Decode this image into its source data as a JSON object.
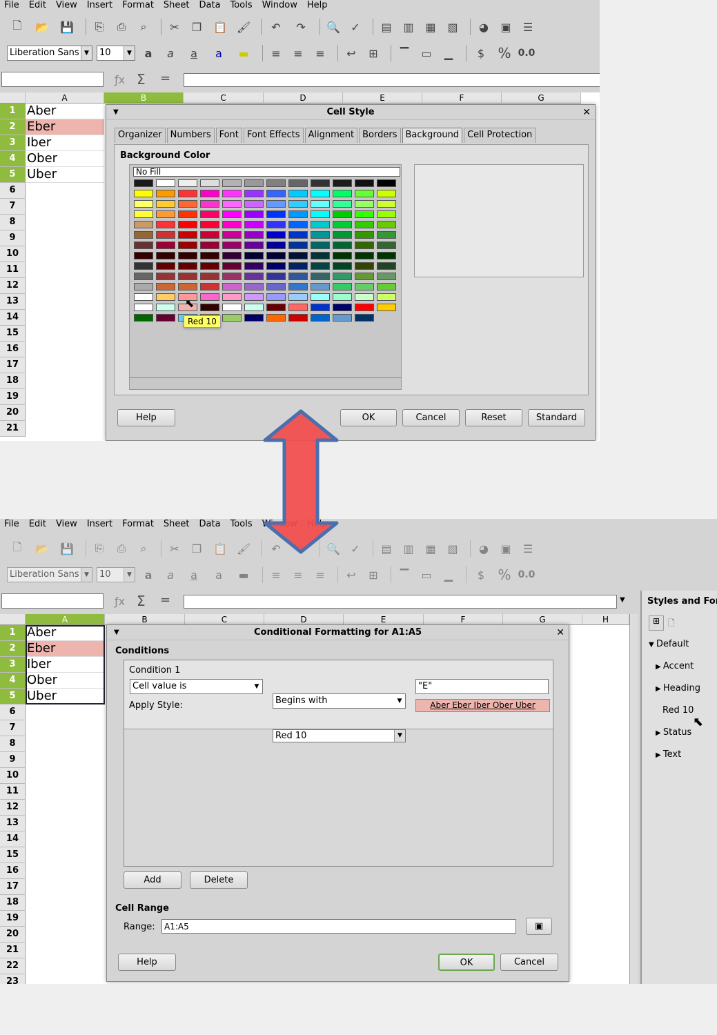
{
  "menu": [
    "File",
    "Edit",
    "View",
    "Insert",
    "Format",
    "Sheet",
    "Data",
    "Tools",
    "Window",
    "Help"
  ],
  "font_name": "Liberation Sans",
  "font_size": "10",
  "toolbar_text": {
    "percent": "%",
    "decimal": "0.0"
  },
  "columns": [
    "A",
    "B",
    "C",
    "D",
    "E",
    "F",
    "G",
    "H"
  ],
  "cells_a": [
    "Aber",
    "Eber",
    "Iber",
    "Ober",
    "Uber"
  ],
  "rows_top": [
    "1",
    "2",
    "3",
    "4",
    "5",
    "6",
    "7",
    "8",
    "9",
    "10",
    "11",
    "12",
    "13",
    "14",
    "15",
    "16",
    "17",
    "18",
    "19",
    "20",
    "21"
  ],
  "rows_bottom": [
    "1",
    "2",
    "3",
    "4",
    "5",
    "6",
    "7",
    "8",
    "9",
    "10",
    "11",
    "12",
    "13",
    "14",
    "15",
    "16",
    "17",
    "18",
    "19",
    "20",
    "21",
    "22",
    "23"
  ],
  "cell_style_dialog": {
    "title": "Cell Style",
    "tabs": [
      "Organizer",
      "Numbers",
      "Font",
      "Font Effects",
      "Alignment",
      "Borders",
      "Background",
      "Cell Protection"
    ],
    "active_tab": "Background",
    "section": "Background Color",
    "no_fill": "No Fill",
    "tooltip": "Red 10",
    "buttons": {
      "help": "Help",
      "ok": "OK",
      "cancel": "Cancel",
      "reset": "Reset",
      "standard": "Standard"
    },
    "palette": [
      [
        "#1a1a1a",
        "#ffffff",
        "#eeeeee",
        "#dddddd",
        "#b2b2b2",
        "#999999",
        "#808080",
        "#666666",
        "#333333",
        "#1c1c1c",
        "#111111",
        "#000000"
      ],
      [
        "#ffff00",
        "#ff9900",
        "#ff3333",
        "#ff00cc",
        "#ff33ff",
        "#9933ff",
        "#3366ff",
        "#00ccff",
        "#00ffff",
        "#00ff66",
        "#66ff33",
        "#ccff00"
      ],
      [
        "#ffff66",
        "#ffcc33",
        "#ff6633",
        "#ff33cc",
        "#ff66ff",
        "#cc66ff",
        "#6699ff",
        "#33ccff",
        "#66ffff",
        "#33ff99",
        "#99ff66",
        "#ccff33"
      ],
      [
        "#ffff33",
        "#ff9933",
        "#ff3300",
        "#ff0066",
        "#ff00ff",
        "#9900ff",
        "#0033ff",
        "#0099ff",
        "#00ffff",
        "#00cc00",
        "#33ff00",
        "#99ff00"
      ],
      [
        "#cc9966",
        "#ff3333",
        "#ff0000",
        "#ff0033",
        "#ff00cc",
        "#cc00ff",
        "#3333ff",
        "#0066ff",
        "#00cccc",
        "#00cc33",
        "#33cc00",
        "#66cc00"
      ],
      [
        "#996633",
        "#cc3333",
        "#cc0000",
        "#cc0033",
        "#cc0099",
        "#9900cc",
        "#0000cc",
        "#0033cc",
        "#009999",
        "#009933",
        "#339900",
        "#339933"
      ],
      [
        "#663333",
        "#990033",
        "#990000",
        "#990033",
        "#990066",
        "#660099",
        "#000099",
        "#003399",
        "#006666",
        "#006633",
        "#336600",
        "#336633"
      ],
      [
        "#330000",
        "#330000",
        "#330000",
        "#330000",
        "#330033",
        "#000033",
        "#000033",
        "#001133",
        "#003333",
        "#003300",
        "#003300",
        "#003300"
      ],
      [
        "#333333",
        "#660000",
        "#660000",
        "#660000",
        "#660033",
        "#330066",
        "#000066",
        "#002266",
        "#004444",
        "#004422",
        "#334400",
        "#224422"
      ],
      [
        "#666666",
        "#993333",
        "#993333",
        "#993333",
        "#993366",
        "#663399",
        "#333399",
        "#335599",
        "#336666",
        "#339966",
        "#669933",
        "#669966"
      ],
      [
        "#aaaaaa",
        "#cc6633",
        "#cc6633",
        "#cc3333",
        "#cc66cc",
        "#9966cc",
        "#6666cc",
        "#3377cc",
        "#6699cc",
        "#33cc66",
        "#66cc66",
        "#66cc33"
      ],
      [
        "#ffffff",
        "#ffcc66",
        "#ff9999",
        "#ff66cc",
        "#ff99cc",
        "#cc99ff",
        "#9999ff",
        "#99ccff",
        "#99ffff",
        "#99ffcc",
        "#ccffcc",
        "#ccff66"
      ],
      [
        "#ffffff",
        "#ccffee",
        "#eeb4ae",
        "#330000",
        "#ffffff",
        "#ccffee",
        "#660000",
        "#ff6666",
        "#0033cc",
        "#000066",
        "#ff0000",
        "#ffcc00"
      ],
      [
        "#006600",
        "#660033",
        "#66ccff",
        "#cc9900",
        "#99cc66",
        "#000066",
        "#ff6600",
        "#cc0000",
        "#0066cc",
        "#6699cc",
        "#003366",
        ""
      ]
    ]
  },
  "cond_dialog": {
    "title": "Conditional Formatting for A1:A5",
    "conditions_label": "Conditions",
    "condition_title": "Condition 1",
    "type": "Cell value is",
    "operator": "Begins with",
    "value": "\"E\"",
    "apply_style_label": "Apply Style:",
    "style": "Red 10",
    "preview": "Aber Eber Iber Ober Uber",
    "add": "Add",
    "delete": "Delete",
    "cell_range_label": "Cell Range",
    "range_label": "Range:",
    "range": "A1:A5",
    "help": "Help",
    "ok": "OK",
    "cancel": "Cancel"
  },
  "styles_panel": {
    "title": "Styles and For",
    "items": [
      {
        "label": "Default",
        "expanded": true
      },
      {
        "label": "Accent"
      },
      {
        "label": "Heading"
      },
      {
        "label": "Red 10"
      },
      {
        "label": "Status"
      },
      {
        "label": "Text"
      }
    ]
  },
  "colors": {
    "accent_green": "#8fbc3f",
    "highlight": "#eeb4ae",
    "arrow_fill": "#f24b4b",
    "arrow_stroke": "#4a6fae"
  }
}
